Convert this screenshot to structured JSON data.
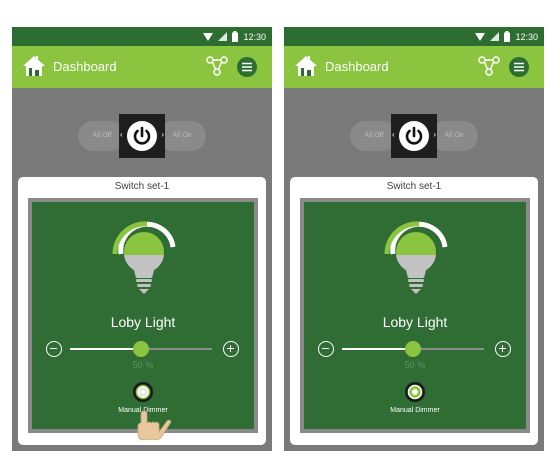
{
  "screens": [
    {
      "status_time": "12:30",
      "app_title": "Dashboard",
      "all_off_label": "All Off",
      "all_on_label": "All On",
      "card_title": "Switch set-1",
      "device_name": "Loby Light",
      "dimmer_level": 50,
      "dimmer_percent": "50 %",
      "mode_label": "Manual Dimmer",
      "touch_indicator": "hand-pointer-icon"
    },
    {
      "status_time": "12:30",
      "app_title": "Dashboard",
      "all_off_label": "All Off",
      "all_on_label": "All On",
      "card_title": "Switch set-1",
      "device_name": "Loby Light",
      "dimmer_level": 50,
      "dimmer_percent": "50 %",
      "mode_label": "Manual Dimmer"
    }
  ],
  "colors": {
    "status_bar": "#2e6d32",
    "app_bar": "#8bc53f",
    "accent_green": "#8bc53f",
    "panel_green": "#2f6d35",
    "control_area": "#7a7a7a"
  }
}
